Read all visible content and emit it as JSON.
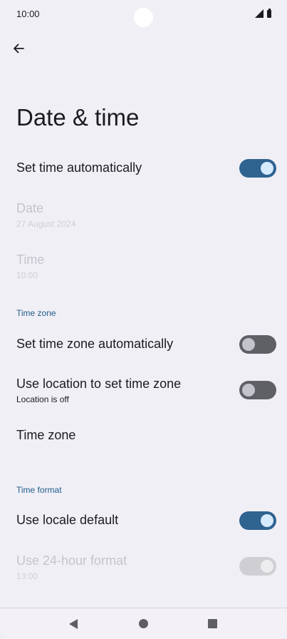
{
  "status_bar": {
    "time": "10:00"
  },
  "header": {
    "title": "Date & time"
  },
  "settings": {
    "set_time_automatically": {
      "label": "Set time automatically",
      "enabled": true
    },
    "date": {
      "label": "Date",
      "value": "27 August 2024"
    },
    "time": {
      "label": "Time",
      "value": "10:00"
    },
    "time_zone_section": {
      "label": "Time zone"
    },
    "set_time_zone_automatically": {
      "label": "Set time zone automatically",
      "enabled": false
    },
    "use_location": {
      "label": "Use location to set time zone",
      "sub": "Location is off",
      "enabled": false
    },
    "time_zone": {
      "label": "Time zone"
    },
    "time_format_section": {
      "label": "Time format"
    },
    "use_locale_default": {
      "label": "Use locale default",
      "enabled": true
    },
    "use_24_hour": {
      "label": "Use 24-hour format",
      "value": "13:00",
      "enabled": true
    }
  },
  "colors": {
    "background": "#f1eff6",
    "switch_on": "#2f6390",
    "switch_off": "#5e6066",
    "section_header": "#205d8a"
  },
  "icons": {
    "back": "arrow-left-icon",
    "signal": "signal-icon",
    "battery": "battery-icon",
    "nav_back": "triangle-back-icon",
    "nav_home": "circle-home-icon",
    "nav_recents": "square-recents-icon"
  }
}
